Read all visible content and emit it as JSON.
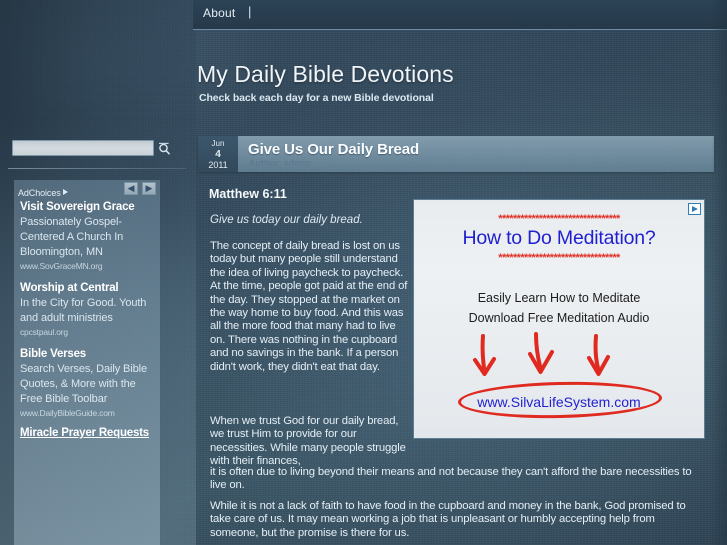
{
  "nav": {
    "items": [
      {
        "label": "About"
      }
    ],
    "separator": "|"
  },
  "header": {
    "title": "My Daily Bible Devotions",
    "tagline": "Check back each day for a new Bible devotional"
  },
  "search": {
    "value": "",
    "placeholder": "",
    "icon": "search-icon"
  },
  "sidebar": {
    "adchoices_label": "AdChoices",
    "prev_label": "◀",
    "next_label": "▶",
    "ads": [
      {
        "title": "Visit Sovereign Grace",
        "body": "Passionately Gospel-Centered A Church In Bloomington, MN",
        "url": "www.SovGraceMN.org",
        "underline": false
      },
      {
        "title": "Worship at Central",
        "body": "In the City for Good. Youth and adult ministries",
        "url": "cpcstpaul.org",
        "underline": false
      },
      {
        "title": "Bible Verses",
        "body": "Search Verses, Daily Bible Quotes, & More with the Free Bible Toolbar",
        "url": "www.DailyBibleGuide.com",
        "underline": false
      },
      {
        "title": "Miracle Prayer Requests",
        "body": "",
        "url": "",
        "underline": true
      }
    ]
  },
  "post": {
    "date": {
      "month": "Jun",
      "day": "4",
      "year": "2011"
    },
    "title": "Give Us Our Daily Bread",
    "author": "Author: admin",
    "verse_ref": "Matthew 6:11",
    "verse_quote": "Give us today our daily bread.",
    "paragraph1": "The concept of daily bread is lost on us today but many people still understand the idea of living paycheck to paycheck.  At the time, people got paid at the end of the day.  They stopped at the market on the way home to buy food.  And this was all the more food that many had to live on.  There was nothing in the cupboard and no savings in the bank.  If a person didn't work, they didn't eat that day.",
    "paragraph2_narrow": "When we trust God for our daily bread, we trust Him to provide for our necessities.  While many people struggle with their finances,",
    "paragraph2_wide": "it is often due to living beyond their means and not because they can't afford the bare necessities to live on.",
    "paragraph3": "While it is not a lack of faith to have food in the cupboard and money in the bank, God promised to take care of us.  It may mean working a job that is unpleasant or humbly accepting help from someone, but the promise is there for us."
  },
  "bigad": {
    "stars": "*********************************",
    "headline": "How to Do Meditation?",
    "line1": "Easily Learn How to Meditate",
    "line2": "Download Free Meditation Audio",
    "url": "www.SilvaLifeSystem.com",
    "adchoices_icon": "adchoices-triangle-icon"
  },
  "colors": {
    "page_bg": "#2e4456",
    "accent_blue": "#1f1fd0",
    "accent_red": "#e02a20",
    "text_light": "#e4eef5"
  }
}
